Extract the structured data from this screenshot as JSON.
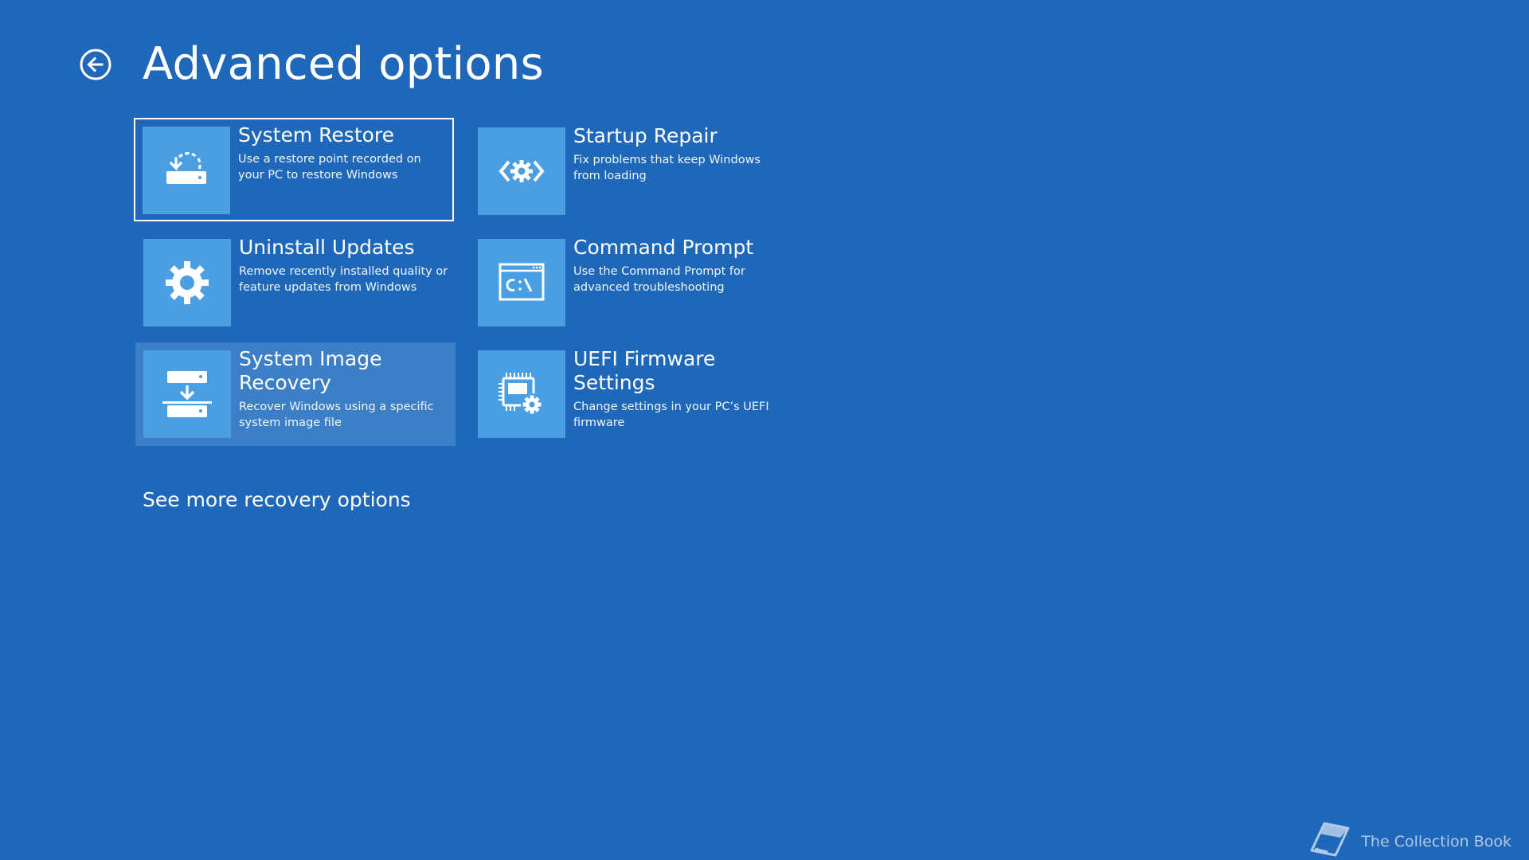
{
  "header": {
    "title": "Advanced options",
    "back_icon": "back-arrow-circle-icon"
  },
  "colors": {
    "background": "#1f68b9",
    "tile_icon_background": "#4a9ee2",
    "hover_background": "#3c7fc6",
    "text": "#ffffff"
  },
  "options": [
    {
      "title": "System Restore",
      "description": "Use a restore point recorded on your PC to restore Windows",
      "icon": "system-restore-icon",
      "state": "focused"
    },
    {
      "title": "Startup Repair",
      "description": "Fix problems that keep Windows from loading",
      "icon": "startup-repair-icon",
      "state": "normal"
    },
    {
      "title": "Uninstall Updates",
      "description": "Remove recently installed quality or feature updates from Windows",
      "icon": "gear-icon",
      "state": "normal"
    },
    {
      "title": "Command Prompt",
      "description": "Use the Command Prompt for advanced troubleshooting",
      "icon": "command-prompt-icon",
      "state": "normal"
    },
    {
      "title": "System Image Recovery",
      "description": "Recover Windows using a specific system image file",
      "icon": "system-image-recovery-icon",
      "state": "hovered"
    },
    {
      "title": "UEFI Firmware Settings",
      "description": "Change settings in your PC’s UEFI firmware",
      "icon": "uefi-firmware-settings-icon",
      "state": "normal"
    }
  ],
  "links": {
    "see_more": "See more recovery options"
  },
  "watermark": {
    "text": "The Collection Book",
    "icon": "book-icon"
  }
}
